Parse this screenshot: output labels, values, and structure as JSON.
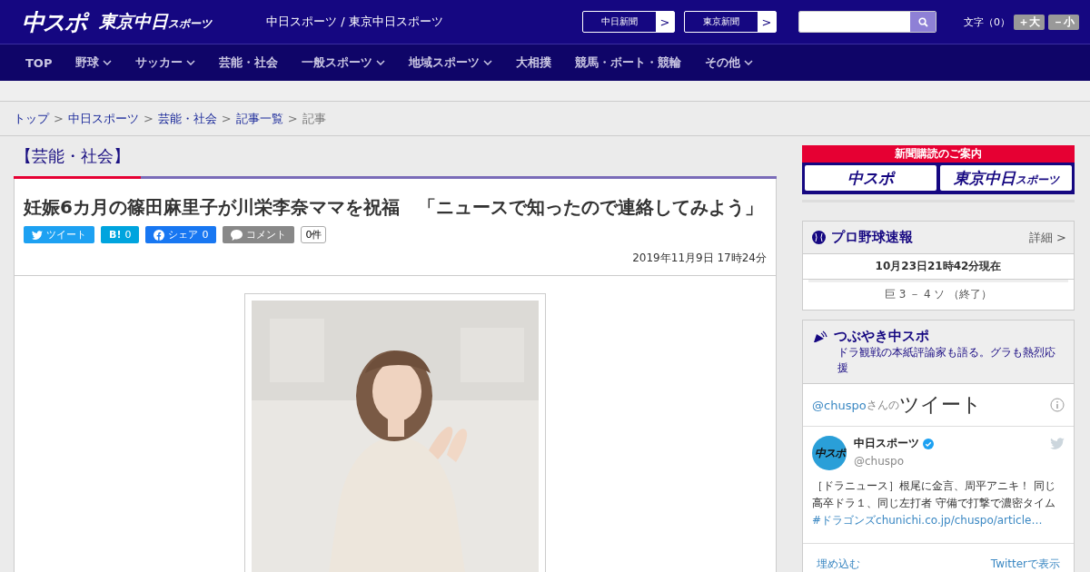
{
  "header": {
    "logo_main": "中スポ",
    "logo_sub": "東京中日",
    "logo_sub_small": "スポーツ",
    "site_title": "中日スポーツ / 東京中日スポーツ",
    "links": [
      {
        "label": "中日新聞",
        "arrow": ">"
      },
      {
        "label": "東京新聞",
        "arrow": ">"
      }
    ],
    "font_size_label": "文字（0）",
    "font_buttons": [
      "＋大",
      "－小"
    ]
  },
  "nav": [
    {
      "label": "TOP",
      "dropdown": false
    },
    {
      "label": "野球",
      "dropdown": true
    },
    {
      "label": "サッカー",
      "dropdown": true
    },
    {
      "label": "芸能・社会",
      "dropdown": false
    },
    {
      "label": "一般スポーツ",
      "dropdown": true
    },
    {
      "label": "地域スポーツ",
      "dropdown": true
    },
    {
      "label": "大相撲",
      "dropdown": false
    },
    {
      "label": "競馬・ボート・競輪",
      "dropdown": false
    },
    {
      "label": "その他",
      "dropdown": true
    }
  ],
  "breadcrumb": {
    "separator": ">",
    "items": [
      {
        "label": "トップ",
        "link": true
      },
      {
        "label": "中日スポーツ",
        "link": true
      },
      {
        "label": "芸能・社会",
        "link": true
      },
      {
        "label": "記事一覧",
        "link": true
      },
      {
        "label": "記事",
        "link": false
      }
    ]
  },
  "article": {
    "category": "【芸能・社会】",
    "title": "妊娠6カ月の篠田麻里子が川栄李奈ママを祝福　「ニュースで知ったので連絡してみよう」",
    "share": [
      {
        "kind": "twitter",
        "label": "ツイート"
      },
      {
        "kind": "hatena",
        "label": "B!",
        "count": "0"
      },
      {
        "kind": "facebook",
        "label": "シェア",
        "count": "0"
      },
      {
        "kind": "comment",
        "label": "コメント"
      }
    ],
    "comment_count": "0件",
    "date": "2019年11月9日 17時24分"
  },
  "sidebar": {
    "subscribe": {
      "heading": "新聞購読のご案内",
      "logos": [
        {
          "main": "中スポ"
        },
        {
          "main": "東京中日",
          "small": "スポーツ"
        }
      ]
    },
    "baseball": {
      "title": "プロ野球速報",
      "detail": "詳細 >",
      "updated": "10月23日21時42分現在",
      "score": "巨 3 － 4 ソ （終了）"
    },
    "tweets": {
      "title": "つぶやき中スポ",
      "subtitle": "ドラ観戦の本紙評論家も語る。グラも熱烈応援",
      "handle": "@chuspo",
      "handle_suffix": "さんの",
      "heading": "ツイート",
      "tweet": {
        "avatar": "中スポ",
        "name": "中日スポーツ",
        "handle": "@chuspo",
        "text": "［ドラニュース］根尾に金言、周平アニキ！ 同じ高卒ドラ１、同じ左打者 守備で打撃で濃密タイム",
        "links": [
          "#ドラゴンズ",
          "chunichi.co.jp/chuspo/article…"
        ]
      },
      "footer": [
        "埋め込む",
        "Twitterで表示"
      ]
    }
  }
}
